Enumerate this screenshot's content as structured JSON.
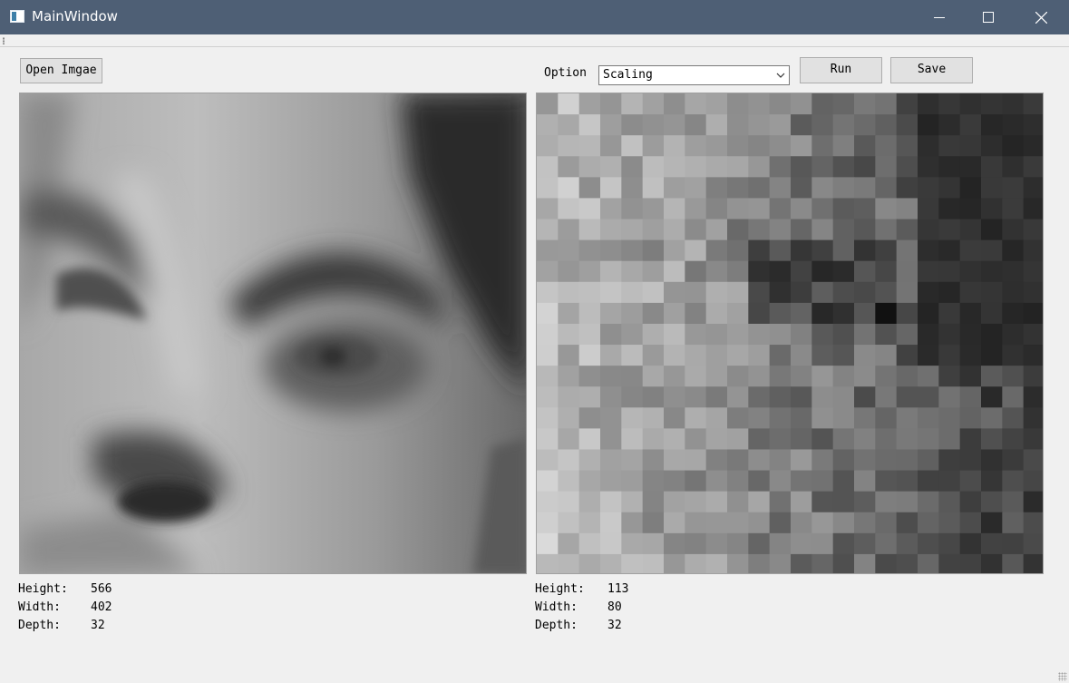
{
  "window": {
    "title": "MainWindow"
  },
  "toolbar": {
    "open_label": "Open Imgae",
    "option_label": "Option",
    "option_value": "Scaling",
    "run_label": "Run",
    "save_label": "Save"
  },
  "original": {
    "height_label": "Height:",
    "height_value": "566",
    "width_label": "Width:",
    "width_value": "402",
    "depth_label": "Depth:",
    "depth_value": "32"
  },
  "result": {
    "height_label": "Height:",
    "height_value": "113",
    "width_label": "Width:",
    "width_value": "80",
    "depth_label": "Depth:",
    "depth_value": "32"
  },
  "icons": {
    "app": "window-icon",
    "minimize": "minimize-icon",
    "maximize": "maximize-icon",
    "close": "close-icon",
    "dropdown": "chevron-down-icon"
  }
}
